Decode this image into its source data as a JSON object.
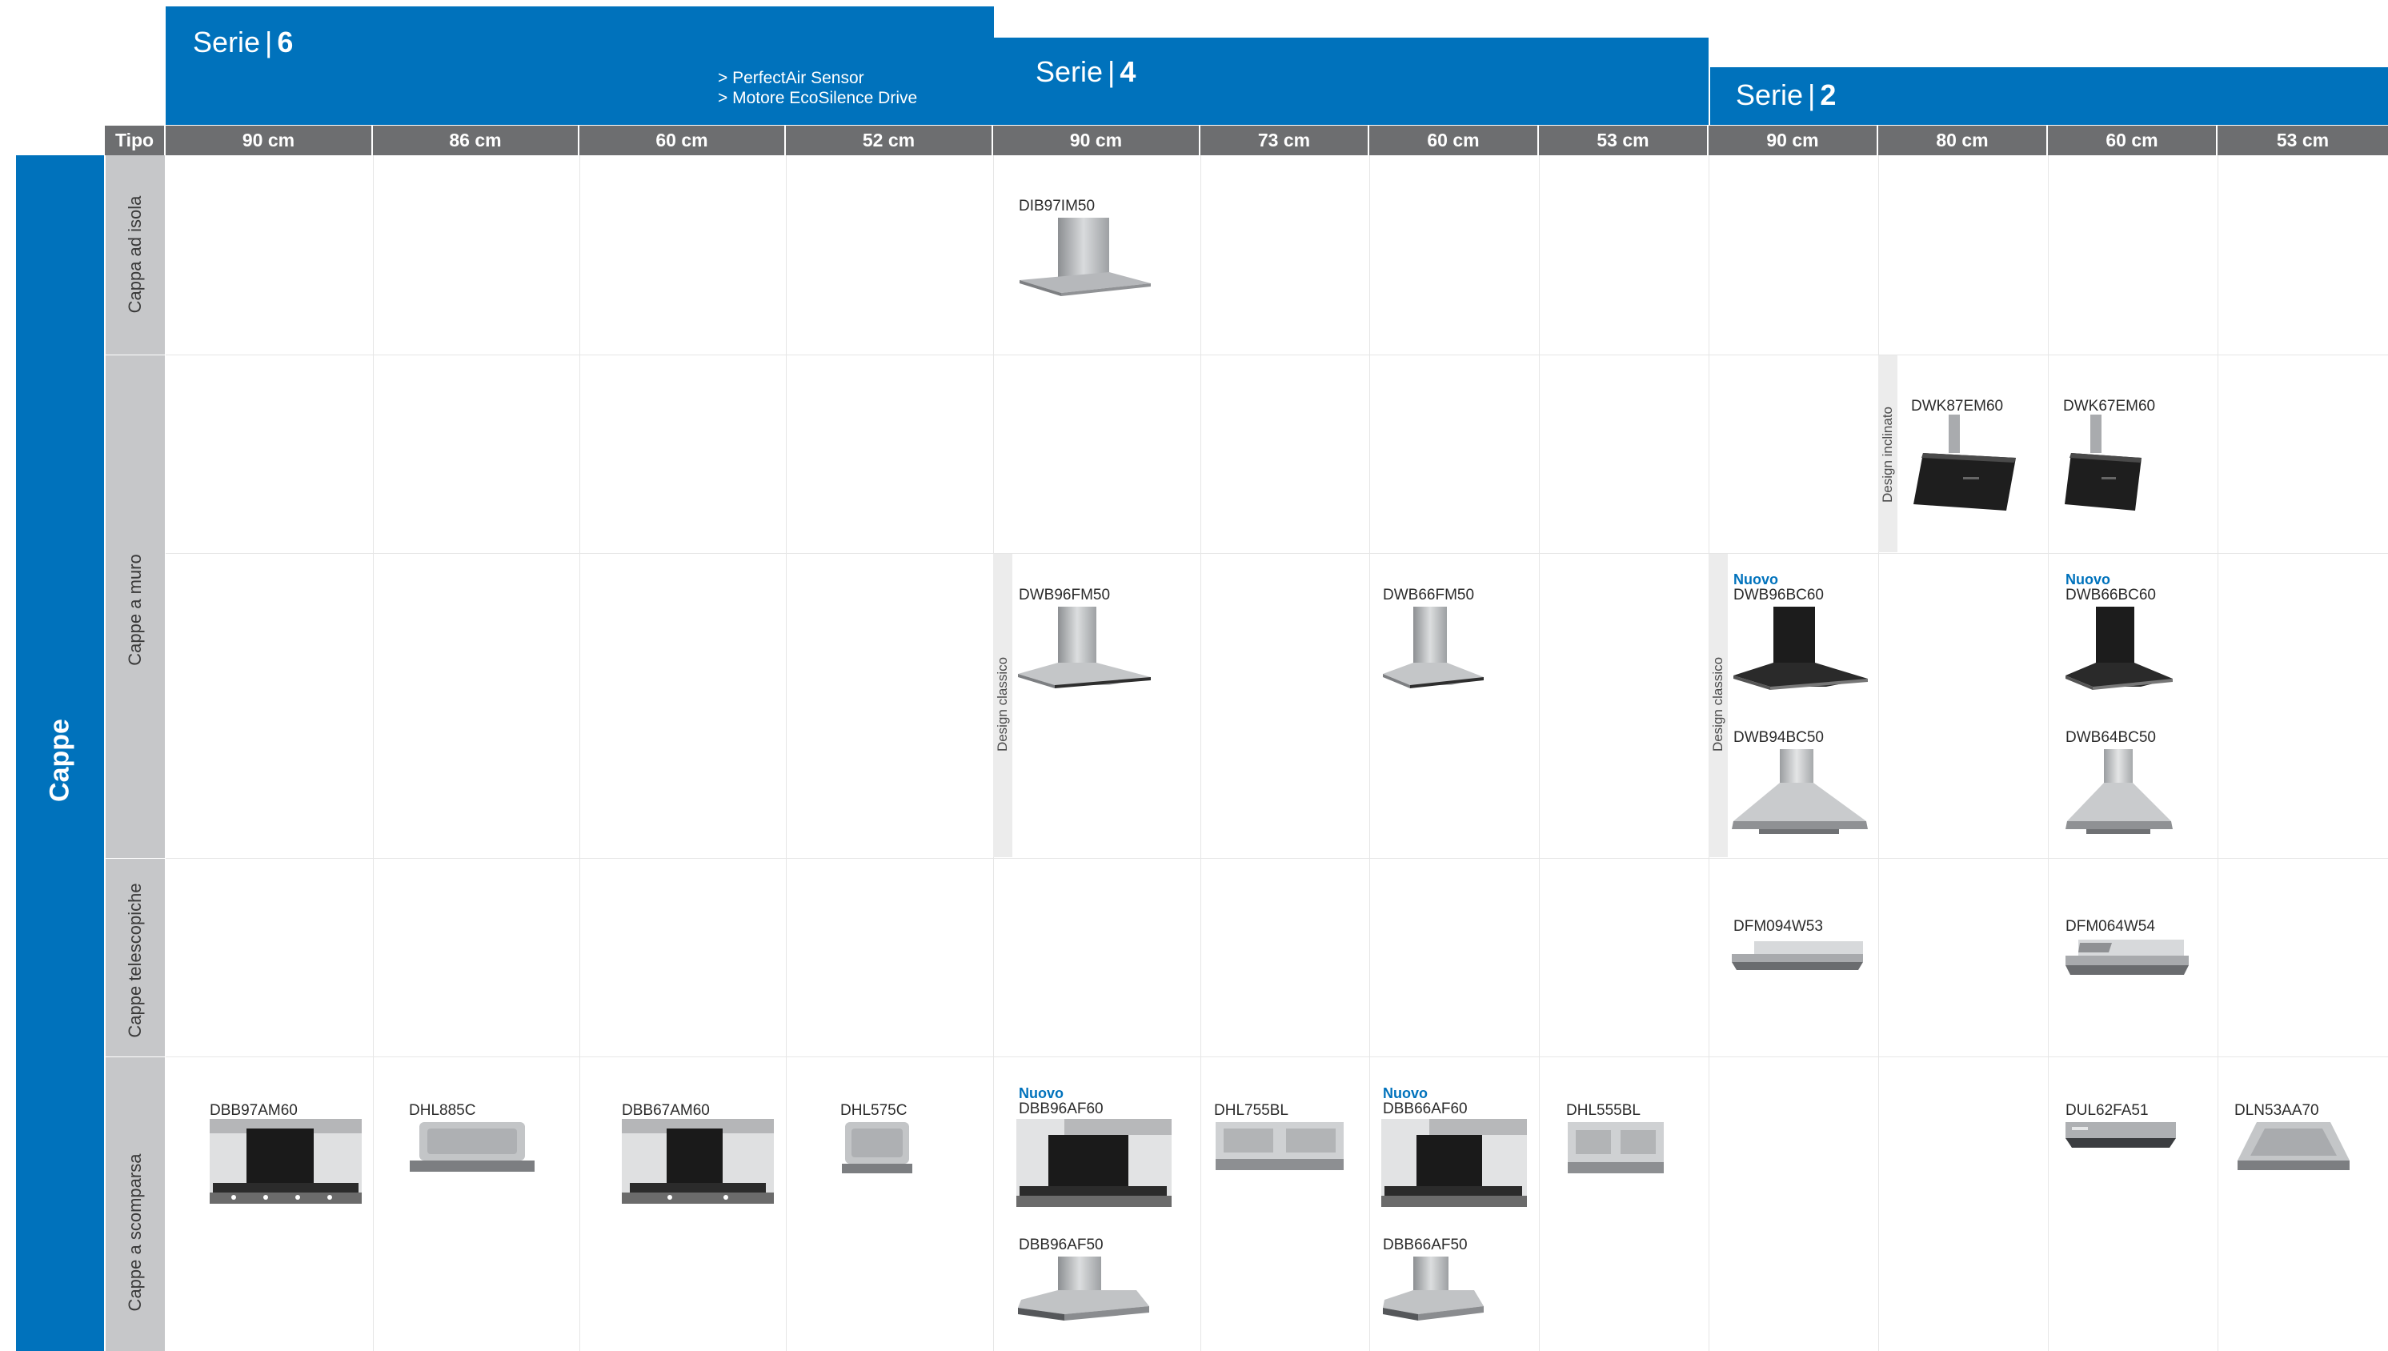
{
  "series": [
    {
      "prefix": "Serie",
      "number": "6",
      "features": [
        "> PerfectAir Sensor",
        "> Motore EcoSilence Drive"
      ]
    },
    {
      "prefix": "Serie",
      "number": "4"
    },
    {
      "prefix": "Serie",
      "number": "2"
    }
  ],
  "header": {
    "tipo_label": "Tipo",
    "widths": [
      "90 cm",
      "86 cm",
      "60 cm",
      "52 cm",
      "90 cm",
      "73 cm",
      "60 cm",
      "53 cm",
      "90 cm",
      "80 cm",
      "60 cm",
      "53 cm"
    ]
  },
  "category": "Cappe",
  "rows": [
    "Cappa ad isola",
    "Cappe a muro",
    "Cappe telescopiche",
    "Cappe a scomparsa"
  ],
  "design_labels": {
    "inclinato": "Design inclinato",
    "classico": "Design classico"
  },
  "nuovo_label": "Nuovo",
  "products": {
    "DIB97IM50": "DIB97IM50",
    "DWK87EM60": "DWK87EM60",
    "DWK67EM60": "DWK67EM60",
    "DWB96FM50": "DWB96FM50",
    "DWB66FM50": "DWB66FM50",
    "DWB96BC60": "DWB96BC60",
    "DWB66BC60": "DWB66BC60",
    "DWB94BC50": "DWB94BC50",
    "DWB64BC50": "DWB64BC50",
    "DFM094W53": "DFM094W53",
    "DFM064W54": "DFM064W54",
    "DBB97AM60": "DBB97AM60",
    "DHL885C": "DHL885C",
    "DBB67AM60": "DBB67AM60",
    "DHL575C": "DHL575C",
    "DBB96AF60": "DBB96AF60",
    "DHL755BL": "DHL755BL",
    "DBB66AF60": "DBB66AF60",
    "DHL555BL": "DHL555BL",
    "DUL62FA51": "DUL62FA51",
    "DLN53AA70": "DLN53AA70",
    "DBB96AF50": "DBB96AF50",
    "DBB66AF50": "DBB66AF50"
  },
  "colors": {
    "brand_blue": "#0072bc",
    "header_grey": "#6d6e70",
    "side_grey": "#c6c7c9"
  }
}
